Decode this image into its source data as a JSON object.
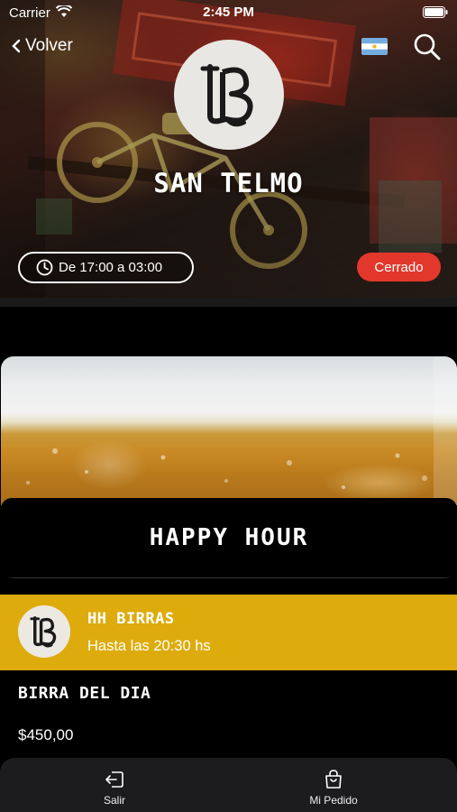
{
  "status_bar": {
    "carrier": "Carrier",
    "time": "2:45 PM"
  },
  "nav": {
    "back_label": "Volver",
    "flag": "argentina-flag-icon",
    "search": "search-icon"
  },
  "store": {
    "title": "SAN TELMO",
    "hours": "De 17:00 a 03:00",
    "status": "Cerrado",
    "status_color": "#e2382c"
  },
  "promo": {
    "title": "HAPPY HOUR"
  },
  "category": {
    "name": "HH BIRRAS",
    "subtitle": "Hasta las 20:30 hs",
    "color": "#ddab0b"
  },
  "item": {
    "name": "BIRRA DEL DIA",
    "price": "$450,00"
  },
  "tab_bar": {
    "tabs": [
      {
        "label": "Salir",
        "icon": "logout-icon"
      },
      {
        "label": "Mi Pedido",
        "icon": "shopping-bag-icon"
      }
    ]
  }
}
